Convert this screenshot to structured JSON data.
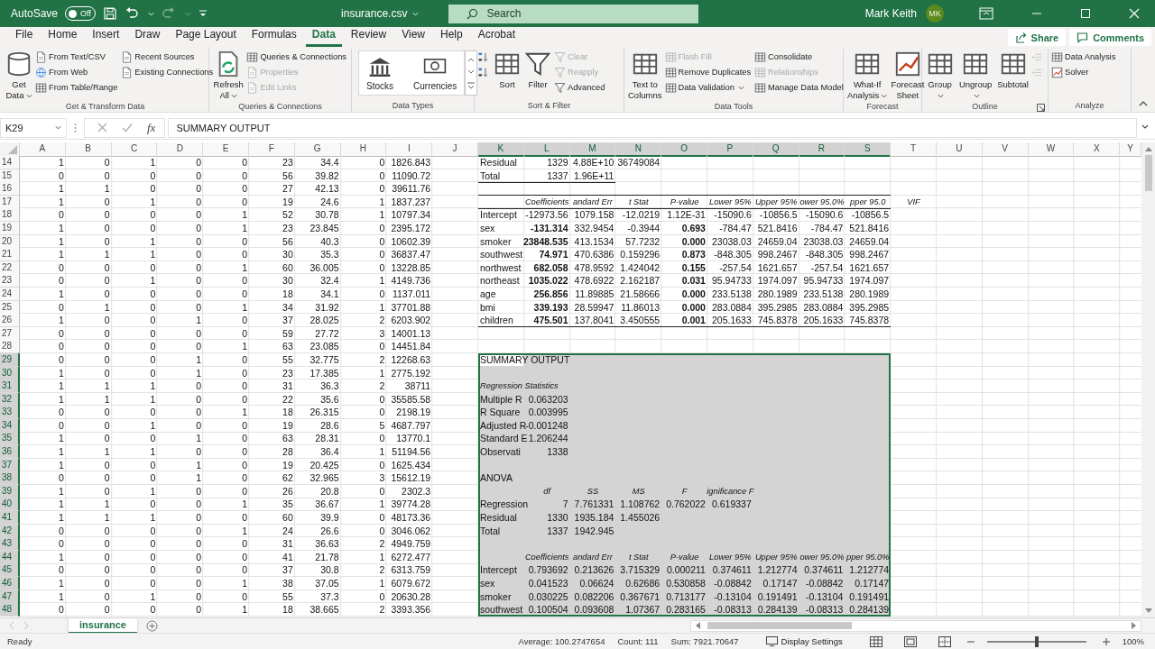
{
  "title_bar": {
    "autosave_label": "AutoSave",
    "autosave": {
      "on": false,
      "label": "Off"
    },
    "file_name": "insurance.csv",
    "search": {
      "placeholder": "Search"
    },
    "user_name": "Mark Keith",
    "user_initials": "MK"
  },
  "menu_tabs": [
    {
      "label": "File",
      "selected": false
    },
    {
      "label": "Home",
      "selected": false
    },
    {
      "label": "Insert",
      "selected": false
    },
    {
      "label": "Draw",
      "selected": false
    },
    {
      "label": "Page Layout",
      "selected": false
    },
    {
      "label": "Formulas",
      "selected": false
    },
    {
      "label": "Data",
      "selected": true
    },
    {
      "label": "Review",
      "selected": false
    },
    {
      "label": "View",
      "selected": false
    },
    {
      "label": "Help",
      "selected": false
    },
    {
      "label": "Acrobat",
      "selected": false
    }
  ],
  "share_button": "Share",
  "comments_button": "Comments",
  "ribbon": [
    {
      "label": "Get & Transform Data",
      "items": [
        {
          "label": "Get Data",
          "kind": "large",
          "dropdown": true,
          "disabled": false
        },
        {
          "label": "From Text/CSV",
          "kind": "small",
          "dropdown": false,
          "disabled": false
        },
        {
          "label": "From Web",
          "kind": "small",
          "dropdown": false,
          "disabled": false
        },
        {
          "label": "From Table/Range",
          "kind": "small",
          "dropdown": false,
          "disabled": false
        },
        {
          "label": "Recent Sources",
          "kind": "small",
          "dropdown": false,
          "disabled": false
        },
        {
          "label": "Existing Connections",
          "kind": "small",
          "dropdown": false,
          "disabled": false
        }
      ]
    },
    {
      "label": "Queries & Connections",
      "items": [
        {
          "label": "Refresh All",
          "kind": "large",
          "dropdown": true,
          "disabled": false
        },
        {
          "label": "Queries & Connections",
          "kind": "small",
          "dropdown": false,
          "disabled": false
        },
        {
          "label": "Properties",
          "kind": "small",
          "dropdown": false,
          "disabled": true
        },
        {
          "label": "Edit Links",
          "kind": "small",
          "dropdown": false,
          "disabled": true
        }
      ]
    },
    {
      "label": "Data Types",
      "items": [
        {
          "label": "Stocks",
          "kind": "gallery",
          "dropdown": false,
          "disabled": false
        },
        {
          "label": "Currencies",
          "kind": "gallery",
          "dropdown": false,
          "disabled": false
        }
      ]
    },
    {
      "label": "Sort & Filter",
      "items": [
        {
          "kind": "small",
          "dropdown": false,
          "disabled": false
        },
        {
          "kind": "small",
          "dropdown": false,
          "disabled": false
        },
        {
          "label": "Sort",
          "kind": "large",
          "dropdown": false,
          "disabled": false
        },
        {
          "label": "Filter",
          "kind": "large",
          "dropdown": false,
          "disabled": false
        },
        {
          "label": "Clear",
          "kind": "small",
          "dropdown": false,
          "disabled": true
        },
        {
          "label": "Reapply",
          "kind": "small",
          "dropdown": false,
          "disabled": true
        },
        {
          "label": "Advanced",
          "kind": "small",
          "dropdown": false,
          "disabled": false
        }
      ]
    },
    {
      "label": "Data Tools",
      "items": [
        {
          "label": "Text to Columns",
          "kind": "large",
          "dropdown": false,
          "disabled": false
        },
        {
          "label": "Flash Fill",
          "kind": "small",
          "dropdown": false,
          "disabled": true
        },
        {
          "label": "Remove Duplicates",
          "kind": "small",
          "dropdown": false,
          "disabled": false
        },
        {
          "label": "Data Validation",
          "kind": "small",
          "dropdown": true,
          "disabled": false
        },
        {
          "label": "Consolidate",
          "kind": "small",
          "dropdown": false,
          "disabled": false
        },
        {
          "label": "Relationships",
          "kind": "small",
          "dropdown": false,
          "disabled": true
        },
        {
          "label": "Manage Data Model",
          "kind": "small",
          "dropdown": false,
          "disabled": false
        }
      ]
    },
    {
      "label": "Forecast",
      "items": [
        {
          "label": "What-If Analysis",
          "kind": "large",
          "dropdown": true,
          "disabled": false
        },
        {
          "label": "Forecast Sheet",
          "kind": "large",
          "dropdown": false,
          "disabled": false
        }
      ]
    },
    {
      "label": "Outline",
      "items": [
        {
          "label": "Group",
          "kind": "large",
          "dropdown": true,
          "disabled": false
        },
        {
          "label": "Ungroup",
          "kind": "large",
          "dropdown": true,
          "disabled": false
        },
        {
          "label": "Subtotal",
          "kind": "large",
          "dropdown": false,
          "disabled": false
        },
        {
          "kind": "small",
          "dropdown": false,
          "disabled": true
        },
        {
          "kind": "small",
          "dropdown": false,
          "disabled": true
        }
      ]
    },
    {
      "label": "Analyze",
      "items": [
        {
          "label": "Data Analysis",
          "kind": "small",
          "dropdown": false,
          "disabled": false
        },
        {
          "label": "Solver",
          "kind": "small",
          "dropdown": false,
          "disabled": false
        }
      ]
    }
  ],
  "formula_bar": {
    "name_box": "K29",
    "function_label": "fx",
    "formula": "SUMMARY OUTPUT"
  },
  "columns": [
    {
      "label": "A",
      "selected": false
    },
    {
      "label": "B",
      "selected": false
    },
    {
      "label": "C",
      "selected": false
    },
    {
      "label": "D",
      "selected": false
    },
    {
      "label": "E",
      "selected": false
    },
    {
      "label": "F",
      "selected": false
    },
    {
      "label": "G",
      "selected": false
    },
    {
      "label": "H",
      "selected": false
    },
    {
      "label": "I",
      "selected": false
    },
    {
      "label": "J",
      "selected": false
    },
    {
      "label": "K",
      "selected": true
    },
    {
      "label": "L",
      "selected": true
    },
    {
      "label": "M",
      "selected": true
    },
    {
      "label": "N",
      "selected": true
    },
    {
      "label": "O",
      "selected": true
    },
    {
      "label": "P",
      "selected": true
    },
    {
      "label": "Q",
      "selected": true
    },
    {
      "label": "R",
      "selected": true
    },
    {
      "label": "S",
      "selected": true
    },
    {
      "label": "T",
      "selected": false
    },
    {
      "label": "U",
      "selected": false
    },
    {
      "label": "V",
      "selected": false
    },
    {
      "label": "W",
      "selected": false
    },
    {
      "label": "X",
      "selected": false
    },
    {
      "label": "Y",
      "selected": false
    }
  ],
  "rows": [
    {
      "row": "14",
      "selected": false,
      "kind": "data",
      "cells": {
        "A": "1",
        "B": "0",
        "C": "1",
        "D": "0",
        "E": "0",
        "F": "23",
        "G": "34.4",
        "H": "0",
        "I": "1826.843",
        "K": "Residual",
        "L": "1329",
        "M": "4.88E+10",
        "N": "36749084"
      }
    },
    {
      "row": "15",
      "selected": false,
      "kind": "end",
      "cells": {
        "A": "0",
        "B": "0",
        "C": "0",
        "D": "0",
        "E": "0",
        "F": "56",
        "G": "39.82",
        "H": "0",
        "I": "11090.72",
        "K": "Total",
        "L": "1337",
        "M": "1.96E+11"
      }
    },
    {
      "row": "16",
      "selected": false,
      "kind": "data",
      "cells": {
        "A": "1",
        "B": "1",
        "C": "0",
        "D": "0",
        "E": "0",
        "F": "27",
        "G": "42.13",
        "H": "0",
        "I": "39611.76"
      }
    },
    {
      "row": "17",
      "selected": false,
      "kind": "header",
      "cells": {
        "A": "1",
        "B": "0",
        "C": "1",
        "D": "0",
        "E": "0",
        "F": "19",
        "G": "24.6",
        "H": "1",
        "I": "1837.237",
        "L": "Coefficients",
        "M": "andard Err",
        "N": "t Stat",
        "O": "P-value",
        "P": "Lower 95%",
        "Q": "Upper 95%",
        "R": "ower 95.0%",
        "S": "pper 95.0",
        "T": "VIF"
      }
    },
    {
      "row": "18",
      "selected": false,
      "kind": "data",
      "cells": {
        "A": "0",
        "B": "0",
        "C": "0",
        "D": "0",
        "E": "1",
        "F": "52",
        "G": "30.78",
        "H": "1",
        "I": "10797.34",
        "K": "Intercept",
        "L": "-12973.56",
        "M": "1079.158",
        "N": "-12.0219",
        "O": "1.12E-31",
        "P": "-15090.6",
        "Q": "-10856.5",
        "R": "-15090.6",
        "S": "-10856.5"
      }
    },
    {
      "row": "19",
      "selected": false,
      "kind": "data",
      "cells": {
        "A": "1",
        "B": "0",
        "C": "0",
        "D": "0",
        "E": "1",
        "F": "23",
        "G": "23.845",
        "H": "0",
        "I": "2395.172",
        "K": "sex",
        "L": {
          "text": "-131.314",
          "bold": true
        },
        "M": "332.9454",
        "N": "-0.3944",
        "O": {
          "text": "0.693",
          "bold": true
        },
        "P": "-784.47",
        "Q": "521.8416",
        "R": "-784.47",
        "S": "521.8416"
      }
    },
    {
      "row": "20",
      "selected": false,
      "kind": "data",
      "cells": {
        "A": "1",
        "B": "0",
        "C": "1",
        "D": "0",
        "E": "0",
        "F": "56",
        "G": "40.3",
        "H": "0",
        "I": "10602.39",
        "K": "smoker",
        "L": {
          "text": "23848.535",
          "bold": true
        },
        "M": "413.1534",
        "N": "57.7232",
        "O": {
          "text": "0.000",
          "bold": true
        },
        "P": "23038.03",
        "Q": "24659.04",
        "R": "23038.03",
        "S": "24659.04"
      }
    },
    {
      "row": "21",
      "selected": false,
      "kind": "data",
      "cells": {
        "A": "1",
        "B": "1",
        "C": "1",
        "D": "0",
        "E": "0",
        "F": "30",
        "G": "35.3",
        "H": "0",
        "I": "36837.47",
        "K": "southwest",
        "L": {
          "text": "74.971",
          "bold": true
        },
        "M": "470.6386",
        "N": "0.159296",
        "O": {
          "text": "0.873",
          "bold": true
        },
        "P": "-848.305",
        "Q": "998.2467",
        "R": "-848.305",
        "S": "998.2467"
      }
    },
    {
      "row": "22",
      "selected": false,
      "kind": "data",
      "cells": {
        "A": "0",
        "B": "0",
        "C": "0",
        "D": "0",
        "E": "1",
        "F": "60",
        "G": "36.005",
        "H": "0",
        "I": "13228.85",
        "K": "northwest",
        "L": {
          "text": "682.058",
          "bold": true
        },
        "M": "478.9592",
        "N": "1.424042",
        "O": {
          "text": "0.155",
          "bold": true
        },
        "P": "-257.54",
        "Q": "1621.657",
        "R": "-257.54",
        "S": "1621.657"
      }
    },
    {
      "row": "23",
      "selected": false,
      "kind": "data",
      "cells": {
        "A": "0",
        "B": "0",
        "C": "1",
        "D": "0",
        "E": "0",
        "F": "30",
        "G": "32.4",
        "H": "1",
        "I": "4149.736",
        "K": "northeast",
        "L": {
          "text": "1035.022",
          "bold": true
        },
        "M": "478.6922",
        "N": "2.162187",
        "O": {
          "text": "0.031",
          "bold": true
        },
        "P": "95.94733",
        "Q": "1974.097",
        "R": "95.94733",
        "S": "1974.097"
      }
    },
    {
      "row": "24",
      "selected": false,
      "kind": "data",
      "cells": {
        "A": "1",
        "B": "0",
        "C": "0",
        "D": "0",
        "E": "0",
        "F": "18",
        "G": "34.1",
        "H": "0",
        "I": "1137.011",
        "K": "age",
        "L": {
          "text": "256.856",
          "bold": true
        },
        "M": "11.89885",
        "N": "21.58666",
        "O": {
          "text": "0.000",
          "bold": true
        },
        "P": "233.5138",
        "Q": "280.1989",
        "R": "233.5138",
        "S": "280.1989"
      }
    },
    {
      "row": "25",
      "selected": false,
      "kind": "data",
      "cells": {
        "A": "0",
        "B": "1",
        "C": "0",
        "D": "0",
        "E": "1",
        "F": "34",
        "G": "31.92",
        "H": "1",
        "I": "37701.88",
        "K": "bmi",
        "L": {
          "text": "339.193",
          "bold": true
        },
        "M": "28.59947",
        "N": "11.86013",
        "O": {
          "text": "0.000",
          "bold": true
        },
        "P": "283.0884",
        "Q": "395.2985",
        "R": "283.0884",
        "S": "395.2985"
      }
    },
    {
      "row": "26",
      "selected": false,
      "kind": "end",
      "cells": {
        "A": "1",
        "B": "0",
        "C": "0",
        "D": "1",
        "E": "0",
        "F": "37",
        "G": "28.025",
        "H": "2",
        "I": "6203.902",
        "K": "children",
        "L": {
          "text": "475.501",
          "bold": true
        },
        "M": "137.8041",
        "N": "3.450555",
        "O": {
          "text": "0.001",
          "bold": true
        },
        "P": "205.1633",
        "Q": "745.8378",
        "R": "205.1633",
        "S": "745.8378"
      }
    },
    {
      "row": "27",
      "selected": false,
      "kind": "data",
      "cells": {
        "A": "0",
        "B": "0",
        "C": "0",
        "D": "0",
        "E": "0",
        "F": "59",
        "G": "27.72",
        "H": "3",
        "I": "14001.13"
      }
    },
    {
      "row": "28",
      "selected": false,
      "kind": "data",
      "cells": {
        "A": "0",
        "B": "0",
        "C": "0",
        "D": "0",
        "E": "1",
        "F": "63",
        "G": "23.085",
        "H": "0",
        "I": "14451.84"
      }
    },
    {
      "row": "29",
      "selected": true,
      "kind": "data",
      "cells": {
        "A": "0",
        "B": "0",
        "C": "0",
        "D": "1",
        "E": "0",
        "F": "55",
        "G": "32.775",
        "H": "2",
        "I": "12268.63",
        "K": "SUMMARY OUTPUT"
      }
    },
    {
      "row": "30",
      "selected": true,
      "kind": "data",
      "cells": {
        "A": "1",
        "B": "0",
        "C": "0",
        "D": "1",
        "E": "0",
        "F": "23",
        "G": "17.385",
        "H": "1",
        "I": "2775.192"
      }
    },
    {
      "row": "31",
      "selected": true,
      "kind": "header",
      "cells": {
        "A": "1",
        "B": "1",
        "C": "1",
        "D": "0",
        "E": "0",
        "F": "31",
        "G": "36.3",
        "H": "2",
        "I": "38711",
        "K": "Regression Statistics"
      }
    },
    {
      "row": "32",
      "selected": true,
      "kind": "data",
      "cells": {
        "A": "1",
        "B": "1",
        "C": "1",
        "D": "0",
        "E": "0",
        "F": "22",
        "G": "35.6",
        "H": "0",
        "I": "35585.58",
        "K": "Multiple R",
        "L": "0.063203"
      }
    },
    {
      "row": "33",
      "selected": true,
      "kind": "data",
      "cells": {
        "A": "0",
        "B": "0",
        "C": "0",
        "D": "0",
        "E": "1",
        "F": "18",
        "G": "26.315",
        "H": "0",
        "I": "2198.19",
        "K": "R Square",
        "L": "0.003995"
      }
    },
    {
      "row": "34",
      "selected": true,
      "kind": "data",
      "cells": {
        "A": "0",
        "B": "0",
        "C": "1",
        "D": "0",
        "E": "0",
        "F": "19",
        "G": "28.6",
        "H": "5",
        "I": "4687.797",
        "K": "Adjusted R",
        "L": "-0.001248"
      }
    },
    {
      "row": "35",
      "selected": true,
      "kind": "data",
      "cells": {
        "A": "1",
        "B": "0",
        "C": "0",
        "D": "1",
        "E": "0",
        "F": "63",
        "G": "28.31",
        "H": "0",
        "I": "13770.1",
        "K": "Standard E",
        "L": "1.206244"
      }
    },
    {
      "row": "36",
      "selected": true,
      "kind": "end",
      "cells": {
        "A": "1",
        "B": "1",
        "C": "1",
        "D": "0",
        "E": "0",
        "F": "28",
        "G": "36.4",
        "H": "1",
        "I": "51194.56",
        "K": "Observati",
        "L": "1338"
      }
    },
    {
      "row": "37",
      "selected": true,
      "kind": "data",
      "cells": {
        "A": "1",
        "B": "0",
        "C": "0",
        "D": "1",
        "E": "0",
        "F": "19",
        "G": "20.425",
        "H": "0",
        "I": "1625.434"
      }
    },
    {
      "row": "38",
      "selected": true,
      "kind": "data",
      "cells": {
        "A": "0",
        "B": "0",
        "C": "0",
        "D": "1",
        "E": "0",
        "F": "62",
        "G": "32.965",
        "H": "3",
        "I": "15612.19",
        "K": "ANOVA"
      }
    },
    {
      "row": "39",
      "selected": true,
      "kind": "header",
      "cells": {
        "A": "1",
        "B": "0",
        "C": "1",
        "D": "0",
        "E": "0",
        "F": "26",
        "G": "20.8",
        "H": "0",
        "I": "2302.3",
        "L": "df",
        "M": "SS",
        "N": "MS",
        "O": "F",
        "P": "ignificance F"
      }
    },
    {
      "row": "40",
      "selected": true,
      "kind": "data",
      "cells": {
        "A": "1",
        "B": "1",
        "C": "0",
        "D": "0",
        "E": "1",
        "F": "35",
        "G": "36.67",
        "H": "1",
        "I": "39774.28",
        "K": "Regression",
        "L": "7",
        "M": "7.761331",
        "N": "1.108762",
        "O": "0.762022",
        "P": "0.619337"
      }
    },
    {
      "row": "41",
      "selected": true,
      "kind": "data",
      "cells": {
        "A": "1",
        "B": "1",
        "C": "1",
        "D": "0",
        "E": "0",
        "F": "60",
        "G": "39.9",
        "H": "0",
        "I": "48173.36",
        "K": "Residual",
        "L": "1330",
        "M": "1935.184",
        "N": "1.455026"
      }
    },
    {
      "row": "42",
      "selected": true,
      "kind": "end",
      "cells": {
        "A": "0",
        "B": "0",
        "C": "0",
        "D": "0",
        "E": "1",
        "F": "24",
        "G": "26.6",
        "H": "0",
        "I": "3046.062",
        "K": "Total",
        "L": "1337",
        "M": "1942.945"
      }
    },
    {
      "row": "43",
      "selected": true,
      "kind": "data",
      "cells": {
        "A": "0",
        "B": "0",
        "C": "0",
        "D": "0",
        "E": "0",
        "F": "31",
        "G": "36.63",
        "H": "2",
        "I": "4949.759"
      }
    },
    {
      "row": "44",
      "selected": true,
      "kind": "header",
      "cells": {
        "A": "1",
        "B": "0",
        "C": "0",
        "D": "0",
        "E": "0",
        "F": "41",
        "G": "21.78",
        "H": "1",
        "I": "6272.477",
        "L": "Coefficients",
        "M": "andard Err",
        "N": "t Stat",
        "O": "P-value",
        "P": "Lower 95%",
        "Q": "Upper 95%",
        "R": "ower 95.0%",
        "S": "pper 95.0%"
      }
    },
    {
      "row": "45",
      "selected": true,
      "kind": "data",
      "cells": {
        "A": "0",
        "B": "0",
        "C": "0",
        "D": "0",
        "E": "0",
        "F": "37",
        "G": "30.8",
        "H": "2",
        "I": "6313.759",
        "K": "Intercept",
        "L": "0.793692",
        "M": "0.213626",
        "N": "3.715329",
        "O": "0.000211",
        "P": "0.374611",
        "Q": "1.212774",
        "R": "0.374611",
        "S": "1.212774"
      }
    },
    {
      "row": "46",
      "selected": true,
      "kind": "data",
      "cells": {
        "A": "1",
        "B": "0",
        "C": "0",
        "D": "0",
        "E": "1",
        "F": "38",
        "G": "37.05",
        "H": "1",
        "I": "6079.672",
        "K": "sex",
        "L": "0.041523",
        "M": "0.06624",
        "N": "0.62686",
        "O": "0.530858",
        "P": "-0.08842",
        "Q": "0.17147",
        "R": "-0.08842",
        "S": "0.17147"
      }
    },
    {
      "row": "47",
      "selected": true,
      "kind": "data",
      "cells": {
        "A": "1",
        "B": "0",
        "C": "1",
        "D": "0",
        "E": "0",
        "F": "55",
        "G": "37.3",
        "H": "0",
        "I": "20630.28",
        "K": "smoker",
        "L": "0.030225",
        "M": "0.082206",
        "N": "0.367671",
        "O": "0.713177",
        "P": "-0.13104",
        "Q": "0.191491",
        "R": "-0.13104",
        "S": "0.191491"
      }
    },
    {
      "row": "48",
      "selected": true,
      "kind": "data",
      "cells": {
        "A": "0",
        "B": "0",
        "C": "0",
        "D": "0",
        "E": "1",
        "F": "18",
        "G": "38.665",
        "H": "2",
        "I": "3393.356",
        "K": "southwest",
        "L": "0.100504",
        "M": "0.093608",
        "N": "1.07367",
        "O": "0.283165",
        "P": "-0.08313",
        "Q": "0.284139",
        "R": "-0.08313",
        "S": "0.284139"
      }
    }
  ],
  "sheet_tabs": [
    {
      "label": "insurance",
      "selected": true
    }
  ],
  "status_bar": {
    "mode": "Ready",
    "average": "Average: 100.2747654",
    "count": "Count: 111",
    "sum": "Sum: 7921.70647",
    "display_settings": "Display Settings",
    "zoom": {
      "level": 0.5
    },
    "zoom_label": "100%"
  }
}
